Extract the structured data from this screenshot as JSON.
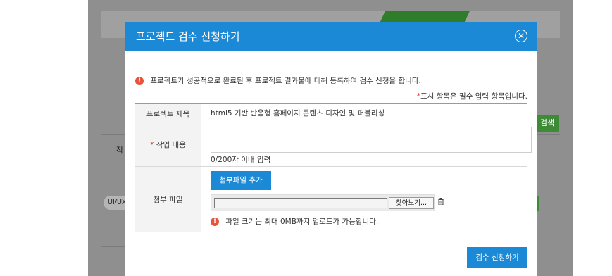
{
  "background": {
    "search_label": "검색",
    "column_label": "작",
    "chip_label": "UI/UX"
  },
  "modal": {
    "title": "프로젝트 검수 신청하기",
    "close_icon": "close-circle-icon",
    "notice": "프로젝트가 성공적으로 완료된 후 프로젝트 결과물에 대해 등록하여 검수 신청을 합니다.",
    "required_mark": "*",
    "required_note": "표시 항목은 필수 입력 항목입니다.",
    "fields": {
      "title": {
        "label": "프로젝트 제목",
        "value": "html5 기반 반응형 홈페이지 콘텐츠 디자인 및 퍼블리싱"
      },
      "content": {
        "required_mark": "*",
        "label": "작업 내용",
        "value": "",
        "counter": "0/200자 이내 입력"
      },
      "attachment": {
        "label": "첨부 파일",
        "add_button": "첨부파일 추가",
        "browse_button": "찾아보기...",
        "file_value": "",
        "notice": "파일 크기는 최대 0MB까지 업로드가 가능합니다."
      }
    },
    "submit_button": "검수 신청하기"
  },
  "colors": {
    "primary": "#1b89d6",
    "info_icon": "#e8543c",
    "required": "#e23b2e",
    "backdrop": "#8f8f8f",
    "bg_green": "#3d8b37"
  }
}
